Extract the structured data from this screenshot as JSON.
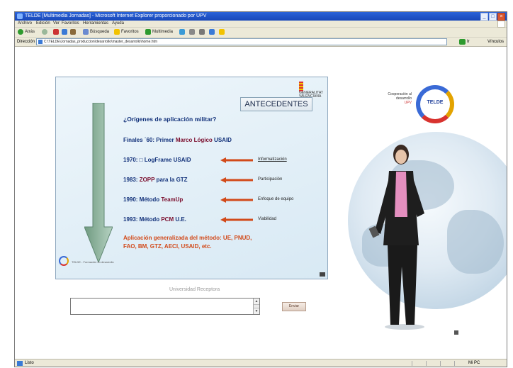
{
  "window": {
    "title": "TELDE [Multimedia Jornadas] - Microsoft Internet Explorer proporcionado por UPV",
    "controls": [
      "_",
      "□",
      "×"
    ]
  },
  "menu": [
    "Archivo",
    "Edición",
    "Ver",
    "Favoritos",
    "Herramientas",
    "Ayuda"
  ],
  "toolbar": {
    "back_label": "Atrás",
    "search_label": "Búsqueda",
    "favorites_label": "Favoritos",
    "multimedia_label": "Multimedia"
  },
  "address": {
    "label": "Dirección",
    "url": "C:\\TELDE\\Jornadas_produccion\\desarrollo\\master_desarrollo\\home.htm",
    "go_label": "Ir",
    "links_label": "Vínculos"
  },
  "slide": {
    "logo_text": "GENERALITAT VALENCIANA",
    "heading": "ANTECEDENTES",
    "question": "¿Orígenes de aplicación militar?",
    "line1": {
      "prefix": "Finales ´60: Primer ",
      "hl": "Marco Lógico",
      "suffix": " USAID"
    },
    "items": [
      {
        "prefix": "1970: □ LogFrame USAID",
        "hl": "",
        "suffix": "",
        "label": "Informatización"
      },
      {
        "prefix": "1983: ",
        "hl": "ZOPP",
        "suffix": " para la GTZ",
        "label": "Participación"
      },
      {
        "prefix": "1990: Método ",
        "hl": "TeamUp",
        "suffix": "",
        "label": "Enfoque de equipo"
      },
      {
        "prefix": "1993: Método ",
        "hl": "PCM",
        "suffix": " U.E.",
        "label": "Viabilidad"
      }
    ],
    "footer_red_1": "Aplicación generalizada del método: UE, PNUD,",
    "footer_red_2": "FAO, BM, GTZ, AECI, USAID, etc.",
    "footer_small": "TELDE - Formación en desarrollo"
  },
  "form": {
    "label": "Universidad Receptora",
    "send_label": "Enviar"
  },
  "brand": {
    "text": "Cooperación al desarrollo",
    "sub": "UPV",
    "ring_text": "TELDE"
  },
  "status": {
    "text": "Listo",
    "zone": "Mi PC"
  },
  "colors": {
    "title_bar": "#1f53c9",
    "chrome": "#ece9d8",
    "slide_blue": "#12317a",
    "slide_accent": "#7a0c2c",
    "slide_red": "#d24a1a"
  }
}
